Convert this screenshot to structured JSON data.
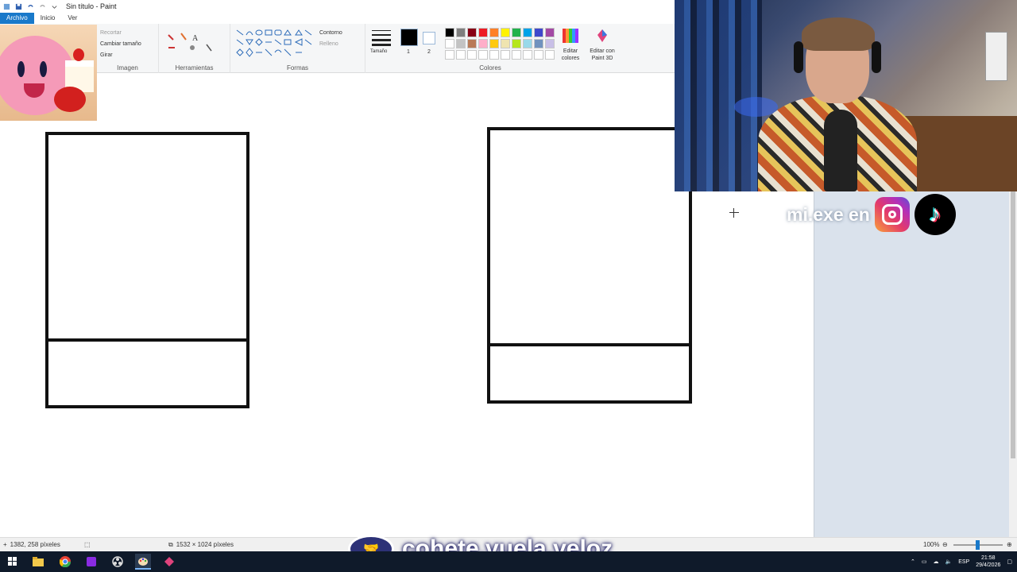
{
  "window": {
    "title": "Sin título - Paint"
  },
  "tabs": [
    {
      "label": "Archivo"
    },
    {
      "label": "Inicio"
    },
    {
      "label": "Ver"
    }
  ],
  "ribbon": {
    "image": {
      "label": "Imagen",
      "crop": "Recortar",
      "resize": "Cambiar tamaño",
      "rotate": "Girar"
    },
    "tools": {
      "label": "Herramientas"
    },
    "shapes": {
      "label": "Formas",
      "outline": "Contorno",
      "fill": "Relleno"
    },
    "size": {
      "label": "Tamaño"
    },
    "colors": {
      "label": "Colores",
      "color1": "1",
      "color2": "2",
      "edit_colors": "Editar colores",
      "edit_3d": "Editar con Paint 3D",
      "palette": [
        "#000000",
        "#7f7f7f",
        "#880015",
        "#ed1c24",
        "#ff7f27",
        "#fff200",
        "#22b14c",
        "#00a2e8",
        "#3f48cc",
        "#a349a4",
        "#ffffff",
        "#c3c3c3",
        "#b97a57",
        "#ffaec9",
        "#ffc90e",
        "#efe4b0",
        "#b5e61d",
        "#99d9ea",
        "#7092be",
        "#c8bfe7",
        "#ffffff",
        "#ffffff",
        "#ffffff",
        "#ffffff",
        "#ffffff",
        "#ffffff",
        "#ffffff",
        "#ffffff",
        "#ffffff",
        "#ffffff"
      ]
    }
  },
  "overlay": {
    "social_text": "mi.exe en",
    "banner_text": "cohete.vuela.veloz"
  },
  "status": {
    "cursor_pos": "1382, 258 píxeles",
    "canvas_size": "1532 × 1024 píxeles",
    "zoom": "100%"
  },
  "taskbar": {
    "language": "ESP",
    "time": "21:58",
    "date": "29/4/2026"
  }
}
